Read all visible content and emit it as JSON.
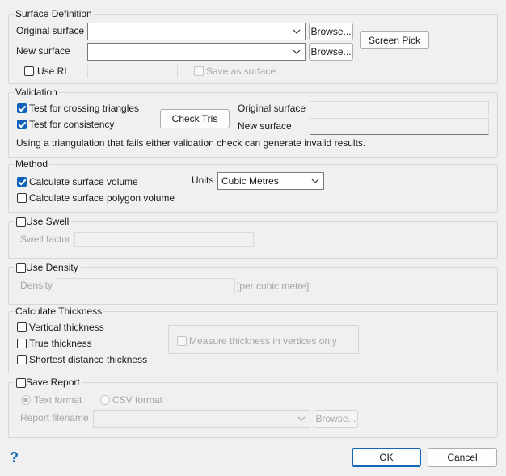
{
  "surface_definition": {
    "legend": "Surface Definition",
    "original_label": "Original surface",
    "new_label": "New surface",
    "browse_label": "Browse...",
    "screen_pick_label": "Screen Pick",
    "use_rl_label": "Use RL",
    "use_rl_checked": false,
    "save_as_surface_label": "Save as surface"
  },
  "validation": {
    "legend": "Validation",
    "crossing_label": "Test for crossing triangles",
    "crossing_checked": true,
    "consistency_label": "Test for consistency",
    "consistency_checked": true,
    "check_tris_label": "Check Tris",
    "original_label": "Original surface",
    "new_label": "New surface",
    "note": "Using a triangulation that fails either validation check can generate invalid results."
  },
  "method": {
    "legend": "Method",
    "volume_label": "Calculate surface volume",
    "volume_checked": true,
    "polygon_label": "Calculate surface polygon volume",
    "polygon_checked": false,
    "units_label": "Units",
    "units_value": "Cubic Metres"
  },
  "swell": {
    "legend": "Use Swell",
    "checked": false,
    "factor_label": "Swell factor"
  },
  "density": {
    "legend": "Use Density",
    "checked": false,
    "density_label": "Density",
    "unit_label": "[per cubic metre]"
  },
  "thickness": {
    "legend": "Calculate Thickness",
    "vertical_label": "Vertical thickness",
    "true_label": "True thickness",
    "shortest_label": "Shortest distance thickness",
    "vertices_only_label": "Measure thickness in vertices only"
  },
  "report": {
    "legend": "Save Report",
    "checked": false,
    "text_format_label": "Text format",
    "text_format_selected": true,
    "csv_format_label": "CSV format",
    "filename_label": "Report filename",
    "browse_label": "Browse..."
  },
  "footer": {
    "help_glyph": "?",
    "ok_label": "OK",
    "cancel_label": "Cancel"
  },
  "colors": {
    "accent": "#0f62b8",
    "help": "#1466b8"
  }
}
